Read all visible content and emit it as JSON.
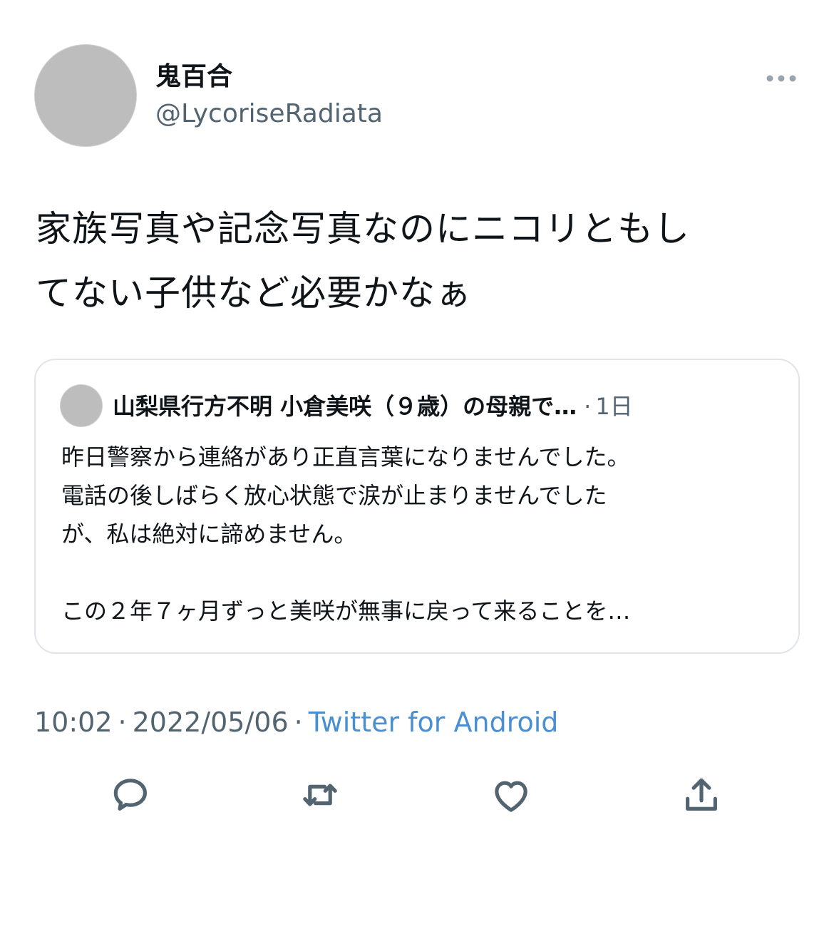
{
  "author": {
    "name": "鬼百合",
    "handle": "@LycoriseRadiata",
    "avatar_icon": "tiger-lily-photo"
  },
  "tweet": {
    "text": "家族写真や記念写真なのにニコリともし\nてない子供など必要かなぁ"
  },
  "quoted_tweet": {
    "author_name": "山梨県行方不明 小倉美咲（９歳）の母親で…",
    "separator": "·",
    "time": "1日",
    "text": "昨日警察から連絡があり正直言葉になりませんでした。\n電話の後しばらく放心状態で涙が止まりませんでした\nが、私は絶対に諦めません。\n\nこの２年７ヶ月ずっと美咲が無事に戻って来ることを…",
    "avatar_icon": "profile-photo"
  },
  "meta": {
    "time": "10:02",
    "dot1": "·",
    "date": "2022/05/06",
    "dot2": "·",
    "source": "Twitter for Android"
  },
  "actions": [
    {
      "icon": "reply-icon"
    },
    {
      "icon": "retweet-icon"
    },
    {
      "icon": "like-icon"
    },
    {
      "icon": "share-icon"
    }
  ],
  "colors": {
    "text_primary": "#0f1419",
    "text_secondary": "#536471",
    "link": "#4a8fcf",
    "border": "#e1e4e8"
  }
}
